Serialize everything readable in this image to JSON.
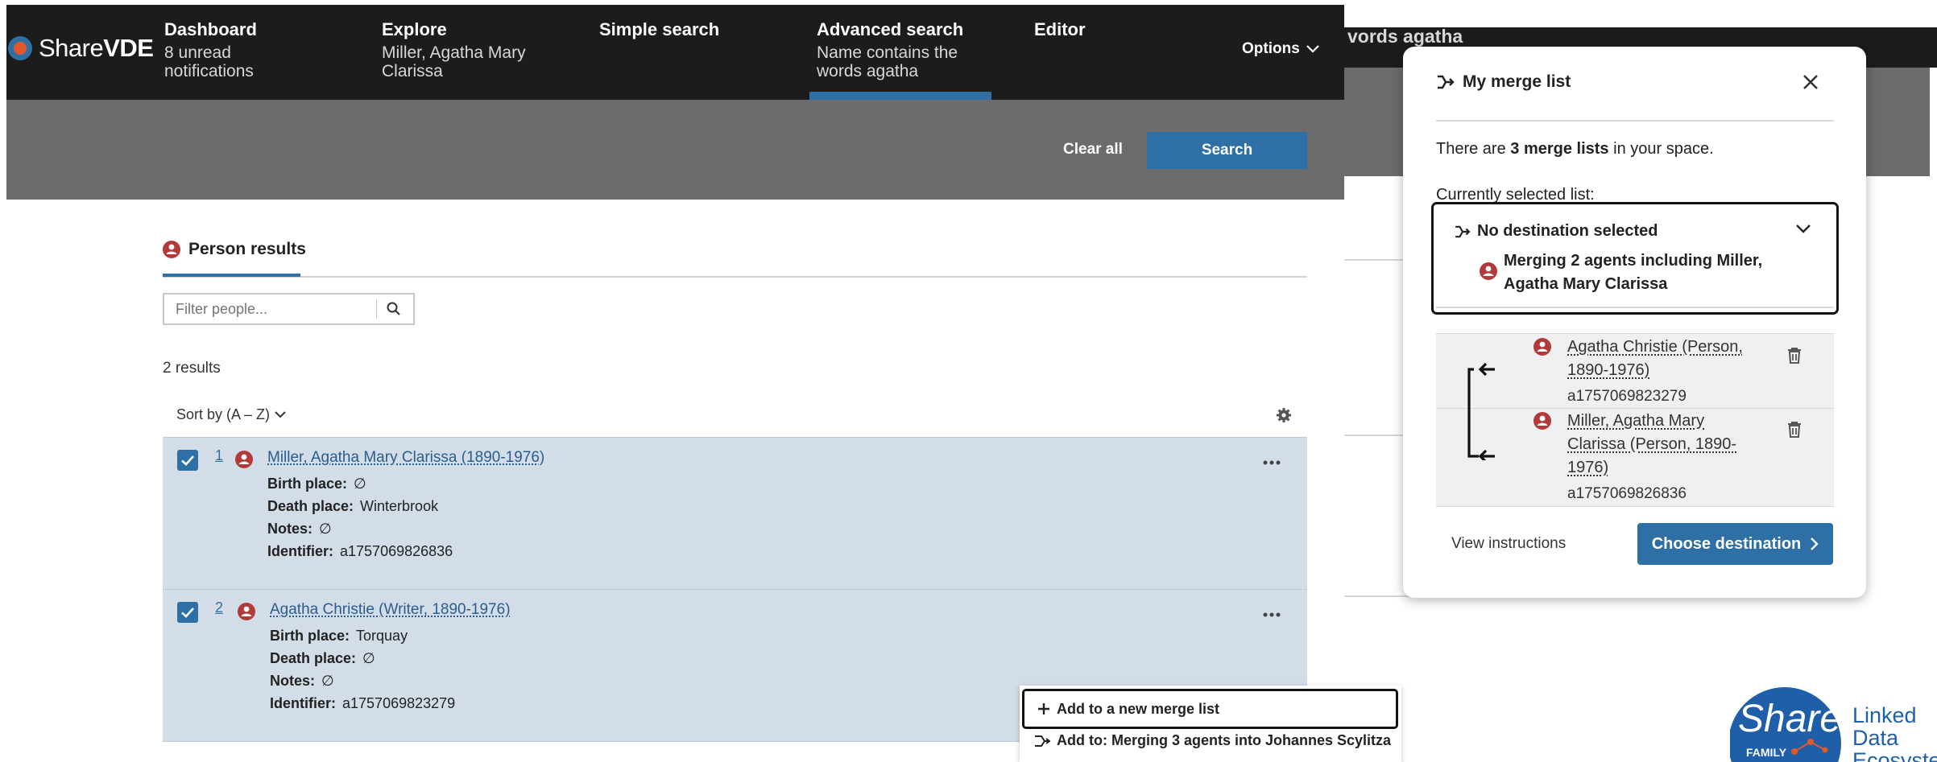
{
  "brand": {
    "name_light": "Share",
    "name_bold": "VDE"
  },
  "nav": {
    "items": [
      {
        "label": "Dashboard",
        "sub": "8 unread notifications"
      },
      {
        "label": "Explore",
        "sub": "Miller, Agatha Mary Clarissa"
      },
      {
        "label": "Simple search",
        "sub": ""
      },
      {
        "label": "Advanced search",
        "sub": "Name contains the words agatha"
      },
      {
        "label": "Editor",
        "sub": ""
      }
    ],
    "options_label": "Options",
    "background_partial_text": "vords agatha"
  },
  "search": {
    "clear_label": "Clear all",
    "search_label": "Search"
  },
  "results": {
    "tab_label": "Person results",
    "filter_placeholder": "Filter people...",
    "count_text": "2 results",
    "sort_label": "Sort by (A – Z)",
    "items": [
      {
        "num": "1",
        "title": "Miller, Agatha Mary Clarissa (1890-1976)",
        "fields": [
          {
            "k": "Birth place:",
            "v": "∅"
          },
          {
            "k": "Death place:",
            "v": "Winterbrook"
          },
          {
            "k": "Notes:",
            "v": "∅"
          },
          {
            "k": "Identifier:",
            "v": "a1757069826836"
          }
        ],
        "checked": true
      },
      {
        "num": "2",
        "title": "Agatha Christie (Writer, 1890-1976)",
        "fields": [
          {
            "k": "Birth place:",
            "v": "Torquay"
          },
          {
            "k": "Death place:",
            "v": "∅"
          },
          {
            "k": "Notes:",
            "v": "∅"
          },
          {
            "k": "Identifier:",
            "v": "a1757069823279"
          }
        ],
        "checked": true
      }
    ]
  },
  "menu": {
    "new_list_label": "Add to a new merge list",
    "add_to_label": "Add to: Merging 3 agents into Johannes Scylitza"
  },
  "merge_drawer": {
    "title": "My merge list",
    "info_prefix": "There are ",
    "info_bold": "3 merge lists",
    "info_suffix": " in your space.",
    "current_label": "Currently selected list:",
    "selected_destination": "No destination selected",
    "selected_summary": "Merging 2 agents including Miller, Agatha Mary Clarissa",
    "items": [
      {
        "title": "Agatha Christie (Person, 1890-1976)",
        "id": "a1757069823279"
      },
      {
        "title": "Miller, Agatha Mary Clarissa (Person, 1890-1976)",
        "id": "a1757069826836"
      }
    ],
    "instructions_label": "View instructions",
    "choose_label": "Choose destination"
  },
  "share_family_logo": {
    "share": "Share",
    "family": "FAMILY",
    "l1": "Linked",
    "l2": "Data",
    "l3": "Ecosystem"
  },
  "colors": {
    "accent": "#2e6fa6",
    "nav_bg": "#1c1c1c",
    "panel_gray": "#6b6b6b",
    "row_bg": "#d2dde8",
    "person_icon": "#b23a3a"
  }
}
